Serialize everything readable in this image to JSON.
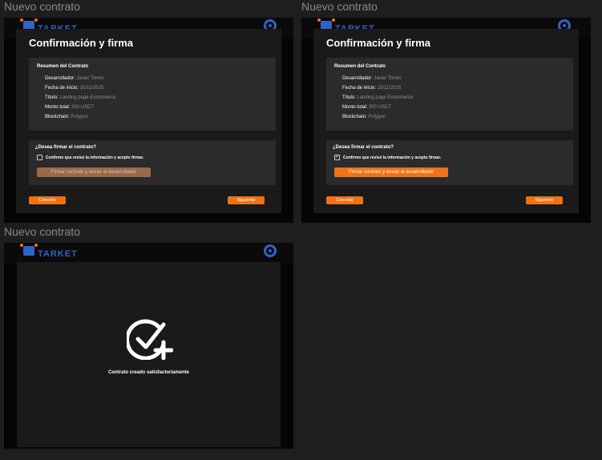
{
  "frames": [
    {
      "title": "Nuevo contrato",
      "brand": "TARKET",
      "modal_title": "Confirmación y firma",
      "summary_heading": "Resumen del Contrato",
      "summary": [
        {
          "key": "Desarrollador:",
          "value": "Javier Torres"
        },
        {
          "key": "Fecha de inicio:",
          "value": "15/11/2025"
        },
        {
          "key": "Título:",
          "value": "Landing page Ecommerce"
        },
        {
          "key": "Monto total:",
          "value": "350 USDT"
        },
        {
          "key": "Blockchain:",
          "value": "Polygon"
        }
      ],
      "sign_question": "¿Desea firmar el contrato?",
      "checkbox_label": "Confirmo que revisé la información y acepto firmar.",
      "checkbox_checked": false,
      "sign_button": "Firmar contrato y enviar al desarrollador",
      "cancel_button": "Cancelar",
      "next_button": "Siguiente"
    },
    {
      "title": "Nuevo contrato",
      "brand": "TARKET",
      "modal_title": "Confirmación y firma",
      "summary_heading": "Resumen del Contrato",
      "summary": [
        {
          "key": "Desarrollador:",
          "value": "Javier Torres"
        },
        {
          "key": "Fecha de inicio:",
          "value": "15/11/2025"
        },
        {
          "key": "Título:",
          "value": "Landing page Ecommerce"
        },
        {
          "key": "Monto total:",
          "value": "350 USDT"
        },
        {
          "key": "Blockchain:",
          "value": "Polygon"
        }
      ],
      "sign_question": "¿Desea firmar el contrato?",
      "checkbox_label": "Confirmo que revisé la información y acepto firmar.",
      "checkbox_checked": true,
      "checkbox_mark": "✓",
      "sign_button": "Firmar contrato y enviar al desarrollador",
      "cancel_button": "Cancelar",
      "next_button": "Siguiente"
    },
    {
      "title": "Nuevo contrato",
      "brand": "TARKET",
      "success_message": "Contrato creado satisfactoriamente"
    }
  ],
  "colors": {
    "accent": "#f07216",
    "accent_disabled": "#9a6a48",
    "brand_blue": "#2f63c6",
    "canvas": "#1e1e1e"
  },
  "icons": {
    "logo": "robot-logo-icon",
    "profile": "profile-ring-icon",
    "success": "check-plus-icon"
  }
}
